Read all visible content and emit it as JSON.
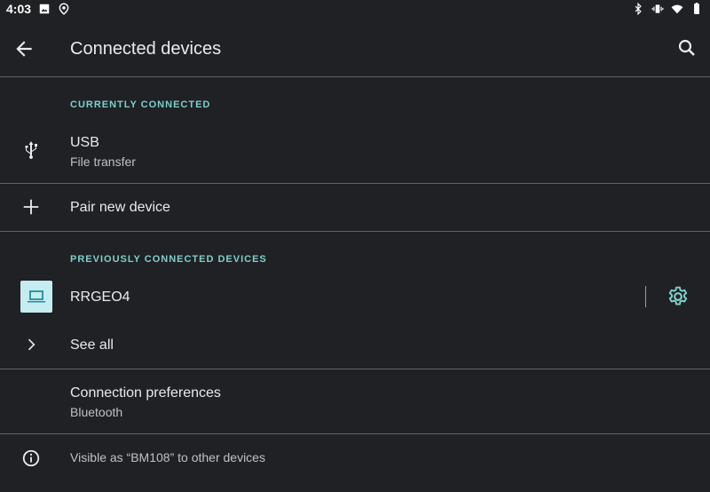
{
  "status_bar": {
    "time": "4:03",
    "left_icons": [
      "image-icon",
      "location-icon"
    ],
    "right_icons": [
      "bluetooth-icon",
      "vibrate-icon",
      "wifi-icon",
      "battery-icon"
    ]
  },
  "app_bar": {
    "title": "Connected devices"
  },
  "sections": {
    "currently_connected": "CURRENTLY CONNECTED",
    "previously_connected": "PREVIOUSLY CONNECTED DEVICES"
  },
  "usb": {
    "title": "USB",
    "subtitle": "File transfer"
  },
  "pair": {
    "title": "Pair new device"
  },
  "device": {
    "name": "RRGEO4"
  },
  "see_all": {
    "title": "See all"
  },
  "connection_prefs": {
    "title": "Connection preferences",
    "subtitle": "Bluetooth"
  },
  "footer": {
    "text": "Visible as “BM108” to other devices"
  },
  "colors": {
    "background": "#202125",
    "accent": "#7fcfc9",
    "device_icon_bg": "#c5ecf0",
    "device_icon_fg": "#1f8f9a"
  }
}
